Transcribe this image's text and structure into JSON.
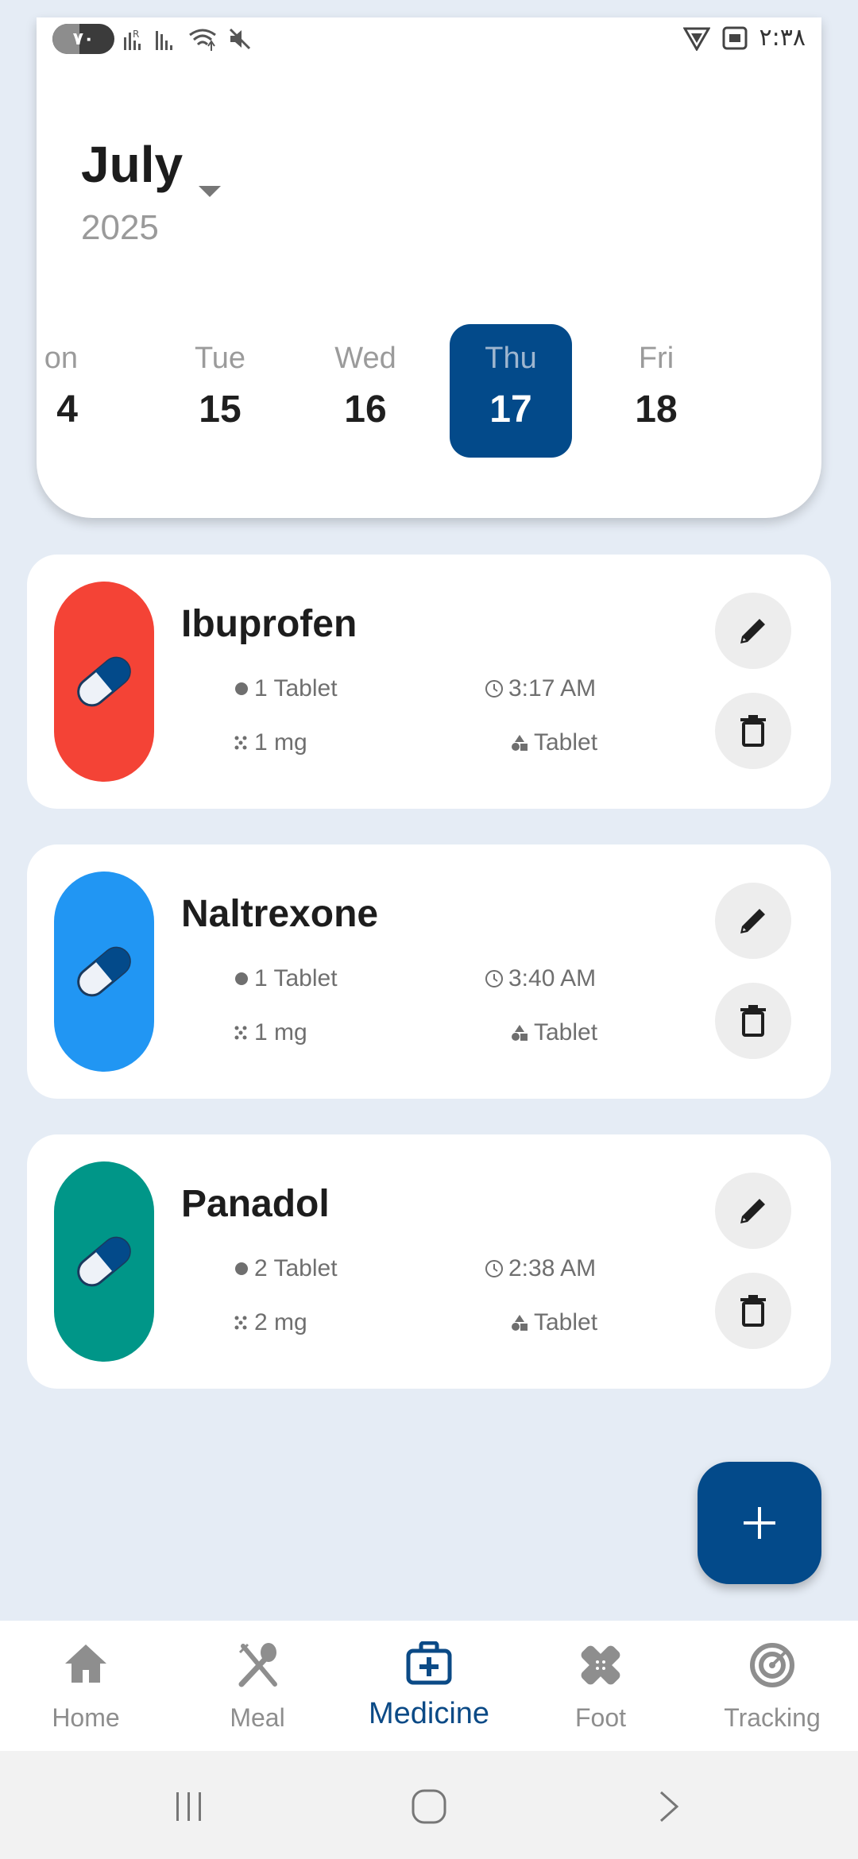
{
  "status_bar": {
    "battery": "۷۰",
    "time": "۲:۳۸",
    "icons": [
      "signal-r-icon",
      "signal-icon",
      "wifi-icon",
      "mute-icon",
      "vpn-shield-icon",
      "screenshot-icon"
    ]
  },
  "calendar": {
    "month": "July",
    "year": "2025",
    "days": [
      {
        "name": "on",
        "num": "4"
      },
      {
        "name": "Tue",
        "num": "15"
      },
      {
        "name": "Wed",
        "num": "16"
      },
      {
        "name": "Thu",
        "num": "17",
        "selected": true
      },
      {
        "name": "Fri",
        "num": "18"
      }
    ]
  },
  "medicines": [
    {
      "name": "Ibuprofen",
      "color": "#f44336",
      "quantity": "1 Tablet",
      "time": "3:17 AM",
      "dose": "1 mg",
      "form": "Tablet"
    },
    {
      "name": "Naltrexone",
      "color": "#2196f3",
      "quantity": "1 Tablet",
      "time": "3:40 AM",
      "dose": "1 mg",
      "form": "Tablet"
    },
    {
      "name": "Panadol",
      "color": "#009688",
      "quantity": "2 Tablet",
      "time": "2:38 AM",
      "dose": "2 mg",
      "form": "Tablet"
    }
  ],
  "fab": {
    "icon": "plus-icon"
  },
  "nav": {
    "items": [
      {
        "label": "Home",
        "icon": "home-icon"
      },
      {
        "label": "Meal",
        "icon": "utensils-icon"
      },
      {
        "label": "Medicine",
        "icon": "medical-kit-icon",
        "active": true
      },
      {
        "label": "Foot",
        "icon": "bandage-icon"
      },
      {
        "label": "Tracking",
        "icon": "target-icon"
      }
    ]
  },
  "colors": {
    "accent": "#034a8a",
    "background": "#e5ecf5"
  }
}
